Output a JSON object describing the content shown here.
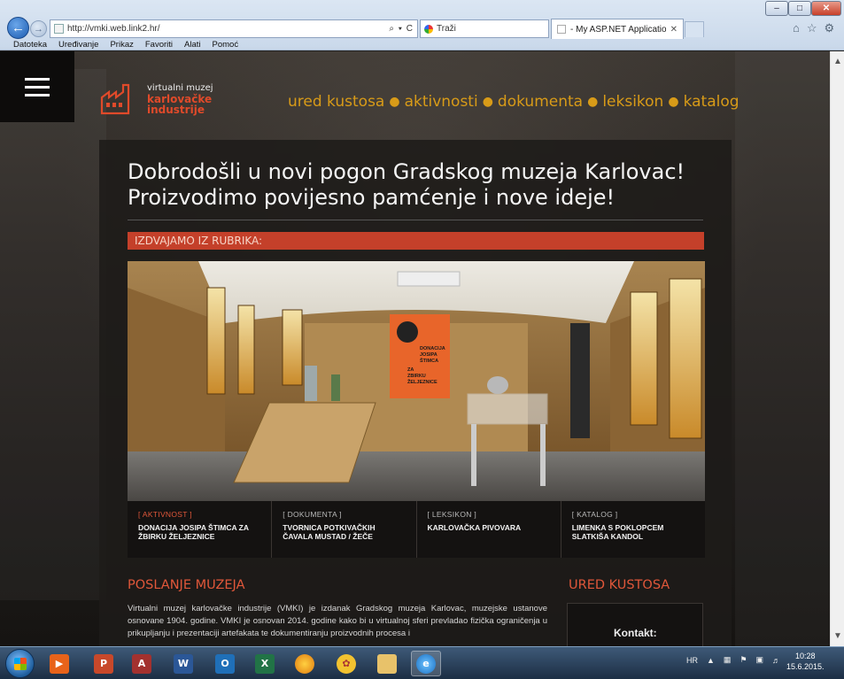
{
  "browser": {
    "url": "http://vmki.web.link2.hr/",
    "address_tools": "⌕ ▾ C",
    "search_placeholder": "Traži",
    "tab_title": "- My ASP.NET Application",
    "menu": [
      "Datoteka",
      "Uređivanje",
      "Prikaz",
      "Favoriti",
      "Alati",
      "Pomoć"
    ]
  },
  "site": {
    "logo": {
      "line1": "virtualni muzej",
      "line2": "karlovačke",
      "line3": "industrije"
    },
    "nav": [
      "ured kustosa",
      "aktivnosti",
      "dokumenta",
      "leksikon",
      "katalog"
    ],
    "headline_1": "Dobrodošli u novi pogon Gradskog muzeja Karlovac!",
    "headline_2": "Proizvodimo povijesno pamćenje i nove ideje!",
    "section_bar": "IZDVAJAMO IZ RUBRIKA:",
    "poster": {
      "line1": "DONACIJA",
      "line2": "JOSIPA",
      "line3": "ŠTIMCA",
      "line4": "ZA",
      "line5": "ZBIRKU",
      "line6": "ŽELJEZNICE"
    },
    "teasers": [
      {
        "category": "[ AKTIVNOST ]",
        "title": "DONACIJA JOSIPA ŠTIMCA ZA ŽBIRKU ŽELJEZNICE"
      },
      {
        "category": "[ DOKUMENTA ]",
        "title": "TVORNICA POTKIVAČKIH ČAVALA MUSTAD / ŽEČE"
      },
      {
        "category": "[ LEKSIKON ]",
        "title": "KARLOVAČKA PIVOVARA"
      },
      {
        "category": "[ KATALOG ]",
        "title": "LIMENKA S POKLOPCEM SLATKIŠA KANDOL"
      }
    ],
    "mission_title": "POSLANJE MUZEJA",
    "mission_text": "Virtualni muzej karlovačke industrije (VMKI) je izdanak Gradskog muzeja Karlovac, muzejske ustanove osnovane 1904. godine. VMKI je osnovan 2014. godine kako bi u virtualnoj sferi prevladao fizička ograničenja u prikupljanju i prezentaciji artefakata te dokumentiranju proizvodnih procesa i",
    "curator_title": "URED KUSTOSA",
    "contact_label": "Kontakt:"
  },
  "taskbar": {
    "apps": [
      {
        "name": "PowerPoint",
        "letter": "P",
        "color": "#c8482a"
      },
      {
        "name": "Access",
        "letter": "A",
        "color": "#a3312f"
      },
      {
        "name": "Word",
        "letter": "W",
        "color": "#2b5797"
      },
      {
        "name": "Outlook",
        "letter": "O",
        "color": "#1f6fb8"
      },
      {
        "name": "Excel",
        "letter": "X",
        "color": "#217346"
      }
    ],
    "language": "HR",
    "time": "10:28",
    "date": "15.6.2015."
  }
}
